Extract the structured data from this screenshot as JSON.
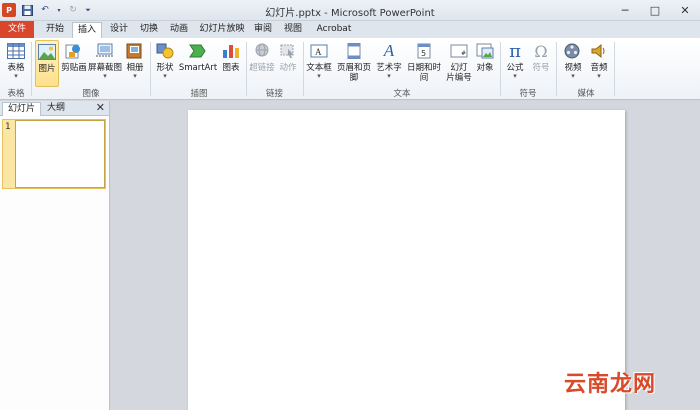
{
  "window": {
    "title": "幻灯片.pptx - Microsoft PowerPoint",
    "minimize": "─",
    "maximize": "□",
    "close": "✕"
  },
  "ribbon_tabs": [
    {
      "label": "文件"
    },
    {
      "label": "开始"
    },
    {
      "label": "插入"
    },
    {
      "label": "设计"
    },
    {
      "label": "切换"
    },
    {
      "label": "动画"
    },
    {
      "label": "幻灯片放映"
    },
    {
      "label": "审阅"
    },
    {
      "label": "视图"
    },
    {
      "label": "Acrobat"
    }
  ],
  "active_tab": "插入",
  "ribbon": {
    "buttons": {
      "table": "表格",
      "picture": "图片",
      "clipart": "剪贴画",
      "screenshot": "屏幕截图",
      "album": "相册",
      "shapes": "形状",
      "smartart": "SmartArt",
      "chart": "图表",
      "hyperlink": "超链接",
      "action": "动作",
      "textbox": "文本框",
      "header_footer": "页眉和页脚",
      "wordart": "艺术字",
      "datetime": "日期和时间",
      "slide_number_1": "幻灯",
      "slide_number_2": "片编号",
      "object": "对象",
      "equation": "公式",
      "symbol": "符号",
      "video": "视频",
      "audio": "音频"
    },
    "groups": {
      "tables": "表格",
      "images": "图像",
      "illustrations": "插图",
      "links": "链接",
      "text": "文本",
      "symbols": "符号",
      "media": "媒体"
    }
  },
  "left_panel": {
    "tabs": [
      "幻灯片",
      "大纲"
    ],
    "close": "✕",
    "slide_number": "1"
  },
  "watermark": "云南龙网",
  "colors": {
    "file_tab": "#d8462b",
    "selection": "#fde08b",
    "watermark": "#d84a2a"
  }
}
